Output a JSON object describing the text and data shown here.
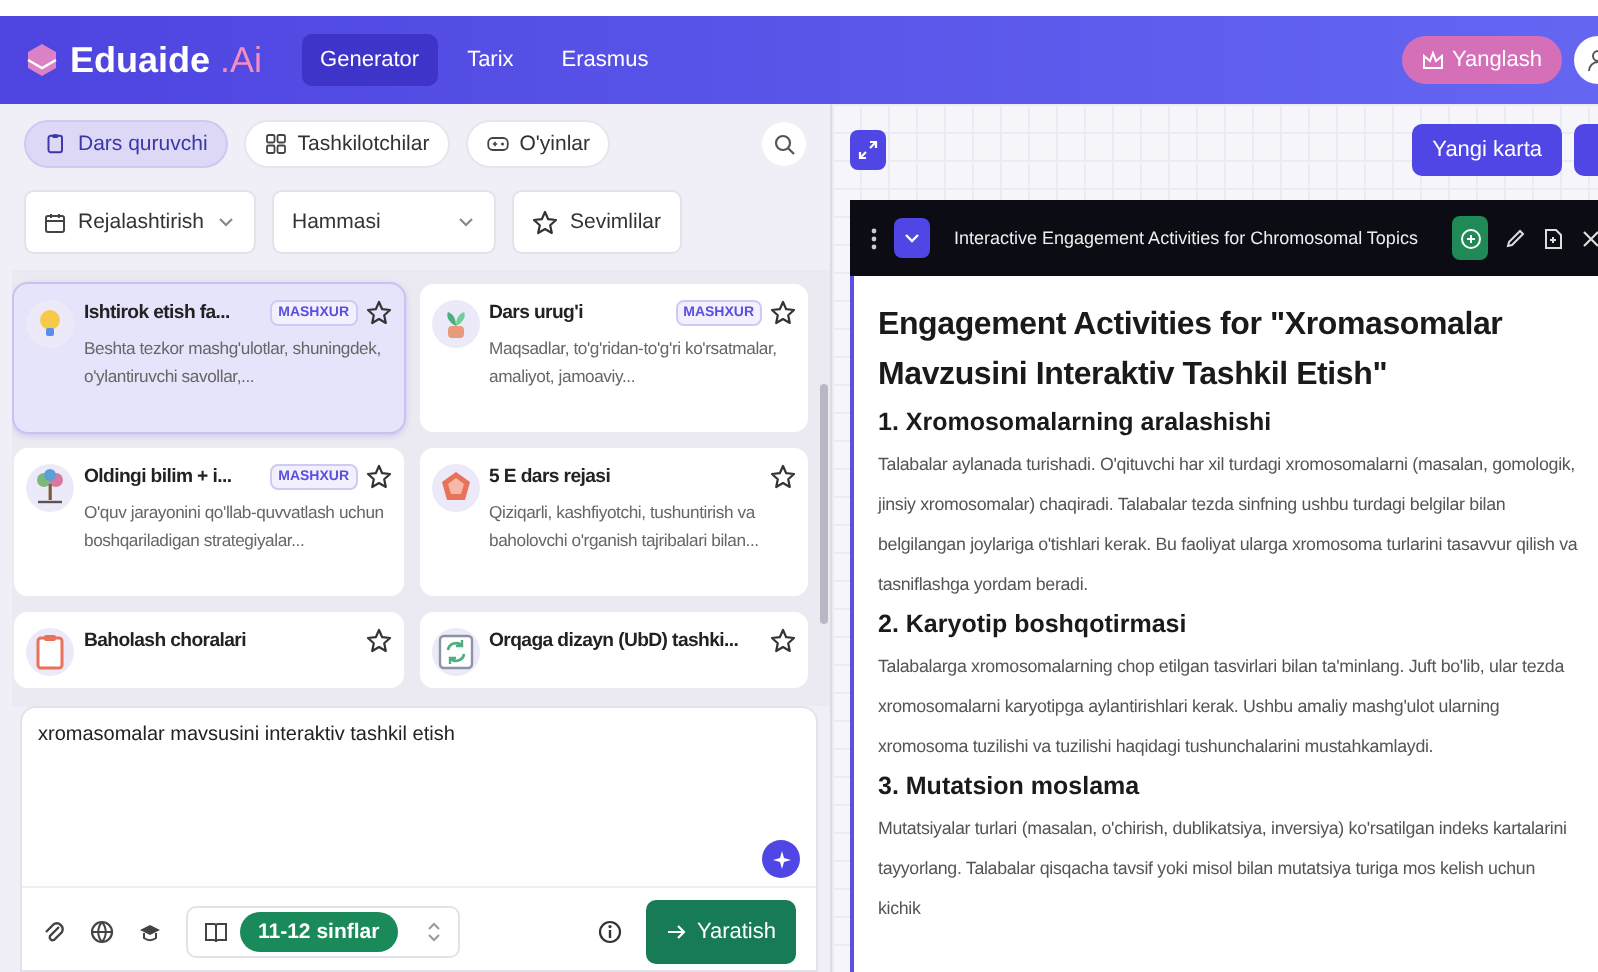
{
  "header": {
    "logo": "Eduaide",
    "logo_suffix": ".Ai",
    "nav": [
      {
        "label": "Generator",
        "selected": true
      },
      {
        "label": "Tarix",
        "selected": false
      },
      {
        "label": "Erasmus",
        "selected": false
      }
    ],
    "upgrade_button": "Yanglash"
  },
  "builder": {
    "tabs": [
      {
        "label": "Dars quruvchi",
        "kind": "clipboard",
        "selected": true
      },
      {
        "label": "Tashkilotchilar",
        "kind": "grid",
        "selected": false
      },
      {
        "label": "O'yinlar",
        "kind": "gamepad",
        "selected": false
      }
    ],
    "filters": {
      "category": "Rejalashtirish",
      "scope": "Hammasi",
      "favorites": "Sevimlilar"
    },
    "cards": [
      {
        "kind": "bulb",
        "title": "Ishtirok etish fa...",
        "badge": "MASHXUR",
        "description": "Beshta tezkor mashg'ulotlar, shuningdek, o'ylantiruvchi savollar,...",
        "selected": true
      },
      {
        "kind": "plant",
        "title": "Dars urug'i",
        "badge": "MASHXUR",
        "description": "Maqsadlar, to'g'ridan-to'g'ri ko'rsatmalar, amaliyot, jamoaviy...",
        "selected": false
      },
      {
        "kind": "tree",
        "title": "Oldingi bilim + i...",
        "badge": "MASHXUR",
        "description": "O'quv jarayonini qo'llab-quvvatlash uchun boshqariladigan strategiyalar...",
        "selected": false
      },
      {
        "kind": "pentagon",
        "title": "5 E dars rejasi",
        "description": "Qiziqarli, kashfiyotchi, tushuntirish va baholovchi o'rganish tajribalari bilan...",
        "selected": false
      },
      {
        "kind": "clipboard",
        "title": "Baholash choralari",
        "selected": false
      },
      {
        "kind": "cycle",
        "title": "Orqaga dizayn (UbD) tashki...",
        "selected": false
      }
    ],
    "prompt": {
      "value": "xromasomalar mavsusini interaktiv tashkil etish",
      "grade": "11-12 sinflar",
      "submit": "Yaratish"
    }
  },
  "document": {
    "new_card_button": "Yangi karta",
    "title": "Interactive Engagement Activities for Chromosomal Topics",
    "heading": "Engagement Activities for \"Xromasomalar Mavzusini Interaktiv Tashkil Etish\"",
    "sections": [
      {
        "heading": "1. Xromosomalarning aralashishi",
        "text": "Talabalar aylanada turishadi. O'qituvchi har xil turdagi xromosomalarni (masalan, gomologik, jinsiy xromosomalar) chaqiradi. Talabalar tezda sinfning ushbu turdagi belgilar bilan belgilangan joylariga o'tishlari kerak. Bu faoliyat ularga xromosoma turlarini tasavvur qilish va tasniflashga yordam beradi."
      },
      {
        "heading": "2. Karyotip boshqotirmasi",
        "text": "Talabalarga xromosomalarning chop etilgan tasvirlari bilan ta'minlang. Juft bo'lib, ular tezda xromosomalarni karyotipga aylantirishlari kerak. Ushbu amaliy mashg'ulot ularning xromosoma tuzilishi va tuzilishi haqidagi tushunchalarini mustahkamlaydi."
      },
      {
        "heading": "3. Mutatsion moslama",
        "text": "Mutatsiyalar turlari (masalan, o'chirish, dublikatsiya, inversiya) ko'rsatilgan indeks kartalarini tayyorlang. Talabalar qisqacha tavsif yoki misol bilan mutatsiya turiga mos kelish uchun kichik"
      }
    ]
  }
}
